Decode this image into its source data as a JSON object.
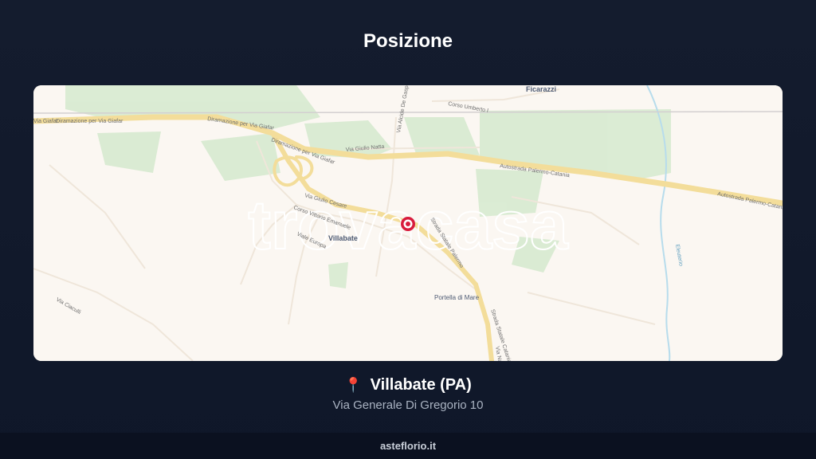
{
  "header": {
    "title": "Posizione"
  },
  "map": {
    "watermark": "trovacasa",
    "labels": {
      "ficarazzi": "Ficarazzi",
      "corso_umberto": "Corso Umberto I",
      "via_giafar_left": "Via Giafar",
      "diramazione_left": "Diramazione per Via Giafar",
      "diramazione_top": "Diramazione per Via Giafar",
      "diramazione_mid": "Diramazione per Via Giafar",
      "via_giulio_natta": "Via Giulio Natta",
      "via_alcide": "Via Alcide De Gasperi",
      "autostrada_1": "Autostrada Palermo-Catania",
      "autostrada_2": "Autostrada Palermo-Catania",
      "via_giulio_cesare": "Via Giulio Cesare",
      "corso_vittorio": "Corso Vittorio Emanuele",
      "viale_europa": "Viale Europa",
      "villabate": "Villabate",
      "strada_statale": "Strada Statale Palermo",
      "strada_statale_2": "Strada Statale Catania",
      "portella": "Portella di Mare",
      "via_ciaculli": "Via Ciaculli",
      "via_na": "Via Na",
      "eleuterio": "Eleuterio"
    },
    "colors": {
      "land": "#fbf7f2",
      "green": "#d7ead0",
      "highway": "#f3dd9a",
      "marker": "#d81b3c",
      "river": "#a9d4e8"
    }
  },
  "location": {
    "pin_icon": "📍",
    "city": "Villabate (PA)",
    "address": "Via Generale Di Gregorio 10"
  },
  "footer": {
    "site": "asteflorio.it"
  }
}
